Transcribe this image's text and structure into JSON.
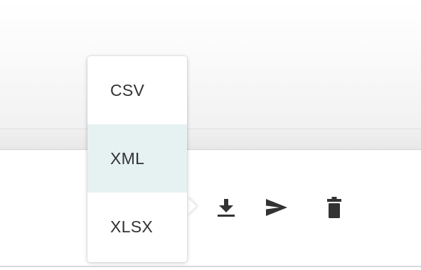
{
  "export_menu": {
    "items": [
      {
        "label": "CSV"
      },
      {
        "label": "XML"
      },
      {
        "label": "XLSX"
      }
    ],
    "highlighted_item": "XML"
  },
  "row_actions": [
    {
      "icon": "download-icon"
    },
    {
      "icon": "send-icon"
    },
    {
      "icon": "delete-icon"
    }
  ],
  "colors": {
    "icon": "#333333",
    "highlight": "#e6f1f2",
    "text": "#333333"
  }
}
